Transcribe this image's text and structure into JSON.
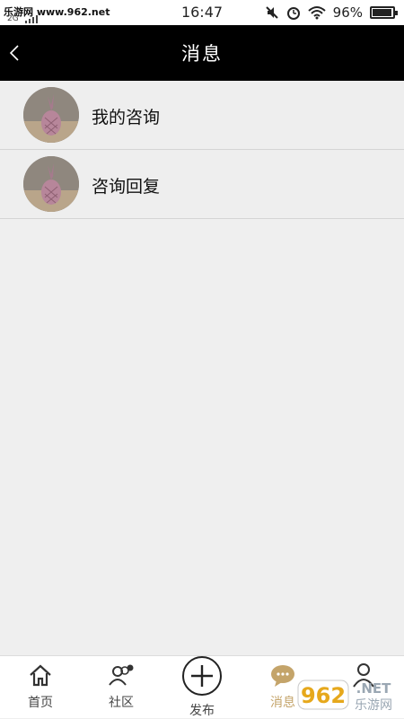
{
  "status_bar": {
    "watermark": "乐游网 www.962.net",
    "network": "2G",
    "time": "16:47",
    "battery_percent": "96%",
    "battery_level": 0.96
  },
  "header": {
    "title": "消息",
    "back_icon": "chevron-left-icon"
  },
  "messages": {
    "items": [
      {
        "label": "我的咨询",
        "avatar_icon": "pineapple-avatar"
      },
      {
        "label": "咨询回复",
        "avatar_icon": "pineapple-avatar"
      }
    ]
  },
  "tabbar": {
    "tabs": [
      {
        "label": "首页",
        "icon": "home-icon"
      },
      {
        "label": "社区",
        "icon": "community-icon"
      },
      {
        "label": "发布",
        "icon": "plus-circle-icon"
      },
      {
        "label": "消息",
        "icon": "chat-bubble-icon",
        "active": true
      },
      {
        "label": "",
        "icon": "person-icon"
      }
    ],
    "active_color": "#c4a46a"
  },
  "watermark_logo": {
    "text_962": "962",
    "text_net": ".NET",
    "text_cn": "乐游网"
  },
  "colors": {
    "header_bg": "#000000",
    "page_bg": "#efefef",
    "accent": "#c4a46a"
  }
}
